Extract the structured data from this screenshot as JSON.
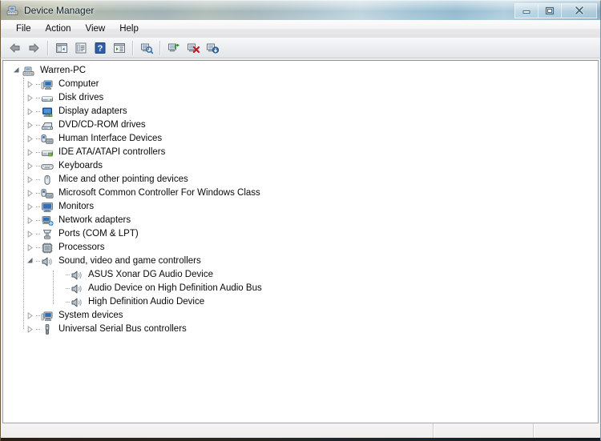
{
  "window": {
    "title": "Device Manager",
    "title_icon": "device-manager-icon",
    "controls": [
      {
        "name": "minimize-button",
        "glyph": "minimize"
      },
      {
        "name": "maximize-button",
        "glyph": "maximize"
      },
      {
        "name": "close-button",
        "glyph": "close"
      }
    ]
  },
  "menubar": {
    "items": [
      {
        "label": "File",
        "name": "menu-file"
      },
      {
        "label": "Action",
        "name": "menu-action"
      },
      {
        "label": "View",
        "name": "menu-view"
      },
      {
        "label": "Help",
        "name": "menu-help"
      }
    ]
  },
  "toolbar": {
    "buttons": [
      {
        "name": "back-button",
        "icon": "back-arrow-icon",
        "tooltip": "Back"
      },
      {
        "name": "forward-button",
        "icon": "forward-arrow-icon",
        "tooltip": "Forward"
      },
      {
        "name": "separator-1",
        "icon": "separator"
      },
      {
        "name": "show-hide-console-tree-button",
        "icon": "console-tree-icon",
        "tooltip": "Show/Hide Console Tree"
      },
      {
        "name": "properties-button",
        "icon": "properties-icon",
        "tooltip": "Properties"
      },
      {
        "name": "help-button",
        "icon": "help-icon",
        "tooltip": "Help"
      },
      {
        "name": "view-button",
        "icon": "view-list-icon",
        "tooltip": "View"
      },
      {
        "name": "separator-2",
        "icon": "separator"
      },
      {
        "name": "scan-for-hardware-changes-button",
        "icon": "scan-hardware-icon",
        "tooltip": "Scan for hardware changes"
      },
      {
        "name": "separator-3",
        "icon": "separator"
      },
      {
        "name": "update-driver-button",
        "icon": "update-driver-icon",
        "tooltip": "Update Driver Software"
      },
      {
        "name": "uninstall-button",
        "icon": "uninstall-device-icon",
        "tooltip": "Uninstall"
      },
      {
        "name": "disable-button",
        "icon": "disable-device-icon",
        "tooltip": "Disable"
      }
    ]
  },
  "tree": {
    "root": {
      "label": "Warren-PC",
      "icon": "computer-root-icon",
      "expanded": true,
      "depth": 0
    },
    "nodes": [
      {
        "label": "Computer",
        "icon": "computer-icon",
        "expanded": false,
        "depth": 1
      },
      {
        "label": "Disk drives",
        "icon": "disk-drive-icon",
        "expanded": false,
        "depth": 1
      },
      {
        "label": "Display adapters",
        "icon": "display-adapter-icon",
        "expanded": false,
        "depth": 1
      },
      {
        "label": "DVD/CD-ROM drives",
        "icon": "dvd-drive-icon",
        "expanded": false,
        "depth": 1
      },
      {
        "label": "Human Interface Devices",
        "icon": "hid-icon",
        "expanded": false,
        "depth": 1
      },
      {
        "label": "IDE ATA/ATAPI controllers",
        "icon": "ide-controller-icon",
        "expanded": false,
        "depth": 1
      },
      {
        "label": "Keyboards",
        "icon": "keyboard-icon",
        "expanded": false,
        "depth": 1
      },
      {
        "label": "Mice and other pointing devices",
        "icon": "mouse-icon",
        "expanded": false,
        "depth": 1
      },
      {
        "label": "Microsoft Common Controller For Windows Class",
        "icon": "hid-icon",
        "expanded": false,
        "depth": 1
      },
      {
        "label": "Monitors",
        "icon": "monitor-icon",
        "expanded": false,
        "depth": 1
      },
      {
        "label": "Network adapters",
        "icon": "network-adapter-icon",
        "expanded": false,
        "depth": 1
      },
      {
        "label": "Ports (COM & LPT)",
        "icon": "port-icon",
        "expanded": false,
        "depth": 1
      },
      {
        "label": "Processors",
        "icon": "processor-icon",
        "expanded": false,
        "depth": 1
      },
      {
        "label": "Sound, video and game controllers",
        "icon": "sound-icon",
        "expanded": true,
        "depth": 1
      },
      {
        "label": "ASUS Xonar DG Audio Device",
        "icon": "sound-device-icon",
        "expanded": null,
        "depth": 2
      },
      {
        "label": "Audio Device on High Definition Audio Bus",
        "icon": "sound-device-icon",
        "expanded": null,
        "depth": 2
      },
      {
        "label": "High Definition Audio Device",
        "icon": "sound-device-icon",
        "expanded": null,
        "depth": 2
      },
      {
        "label": "System devices",
        "icon": "system-device-icon",
        "expanded": false,
        "depth": 1
      },
      {
        "label": "Universal Serial Bus controllers",
        "icon": "usb-icon",
        "expanded": false,
        "depth": 1
      }
    ]
  },
  "statusbar": {
    "message": "",
    "cell_1": "",
    "cell_2": ""
  },
  "colors": {
    "accent_blue": "#2a62b5",
    "help_blue": "#2e5fa8",
    "uninstall_red": "#c01a20",
    "update_green": "#2f8a28",
    "text": "#0a0a0a",
    "client_bg": "#ffffff"
  }
}
